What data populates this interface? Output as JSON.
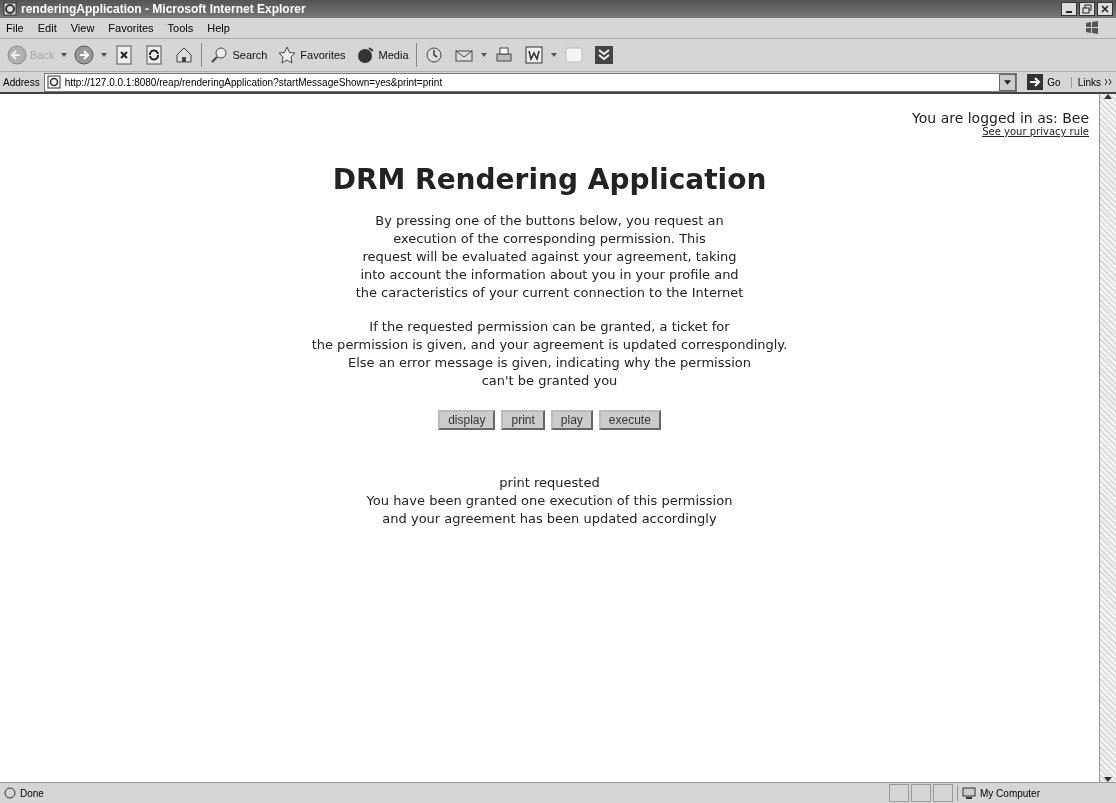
{
  "window": {
    "title": "renderingApplication - Microsoft Internet Explorer"
  },
  "menu": [
    "File",
    "Edit",
    "View",
    "Favorites",
    "Tools",
    "Help"
  ],
  "toolbar": [
    {
      "kind": "back",
      "label": "Back",
      "disabled": true
    },
    {
      "kind": "forward",
      "disabled": false
    },
    {
      "kind": "stop"
    },
    {
      "kind": "refresh"
    },
    {
      "kind": "home"
    },
    {
      "kind": "search",
      "label": "Search"
    },
    {
      "kind": "favorites",
      "label": "Favorites"
    },
    {
      "kind": "media",
      "label": "Media"
    },
    {
      "kind": "history"
    },
    {
      "kind": "mail"
    },
    {
      "kind": "print"
    },
    {
      "kind": "word"
    },
    {
      "kind": "blank"
    },
    {
      "kind": "download"
    }
  ],
  "address": {
    "label": "Address",
    "value": "http://127.0.0.1:8080/reap/renderingApplication?startMessageShown=yes&print=print",
    "go": "Go",
    "links": "Links"
  },
  "page": {
    "login": "You are logged in as: Bee",
    "privacy_link": "See your privacy rule",
    "heading": "DRM Rendering Application",
    "paragraphs": [
      [
        "By pressing one of the buttons below, you request an",
        "execution of the corresponding permission. This",
        "request will be evaluated against your agreement, taking",
        "into account the information about you in your profile and",
        "the caracteristics of your current connection to the Internet"
      ],
      [
        "If the requested permission can be granted, a ticket for",
        "the permission is given, and your agreement is updated correspondingly.",
        "Else an error message is given, indicating why the permission",
        "can't be granted you"
      ]
    ],
    "buttons": [
      "display",
      "print",
      "play",
      "execute"
    ],
    "result": [
      "print requested",
      "You have been granted one execution of this permission",
      "and your agreement has been updated accordingly"
    ]
  },
  "status_bar": {
    "text": "Done",
    "zone": "My Computer"
  }
}
